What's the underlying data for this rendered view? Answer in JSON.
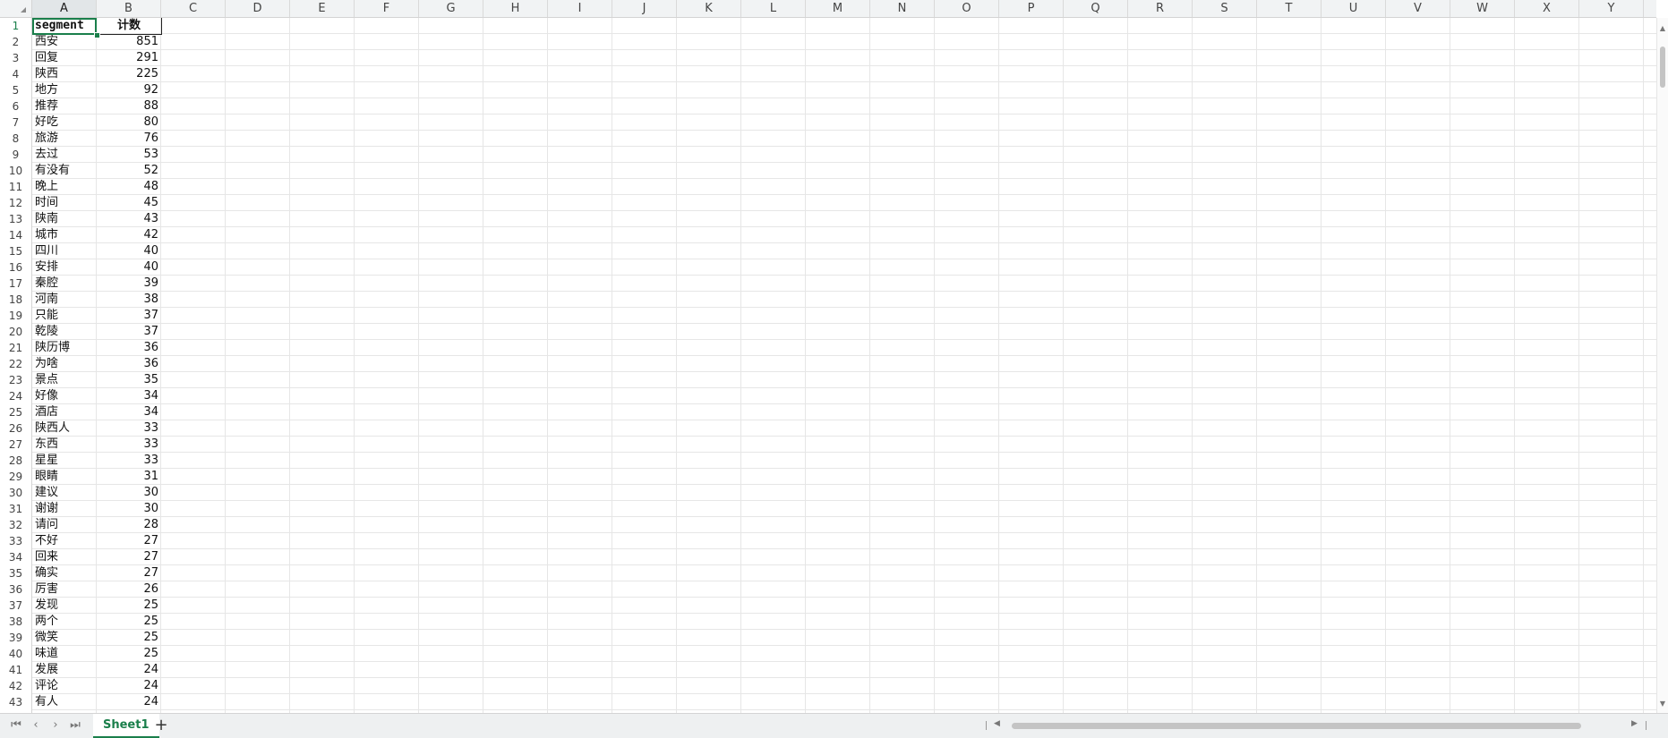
{
  "columns": [
    "A",
    "B",
    "C",
    "D",
    "E",
    "F",
    "G",
    "H",
    "I",
    "J",
    "K",
    "L",
    "M",
    "N",
    "O",
    "P",
    "Q",
    "R",
    "S",
    "T",
    "U",
    "V",
    "W",
    "X",
    "Y"
  ],
  "selected_cell": "A1",
  "header_row": {
    "a": "segment",
    "b": "计数"
  },
  "rows": [
    {
      "n": "2",
      "a": "西安",
      "b": "851"
    },
    {
      "n": "3",
      "a": "回复",
      "b": "291"
    },
    {
      "n": "4",
      "a": "陕西",
      "b": "225"
    },
    {
      "n": "5",
      "a": "地方",
      "b": "92"
    },
    {
      "n": "6",
      "a": "推荐",
      "b": "88"
    },
    {
      "n": "7",
      "a": "好吃",
      "b": "80"
    },
    {
      "n": "8",
      "a": "旅游",
      "b": "76"
    },
    {
      "n": "9",
      "a": "去过",
      "b": "53"
    },
    {
      "n": "10",
      "a": "有没有",
      "b": "52"
    },
    {
      "n": "11",
      "a": "晚上",
      "b": "48"
    },
    {
      "n": "12",
      "a": "时间",
      "b": "45"
    },
    {
      "n": "13",
      "a": "陕南",
      "b": "43"
    },
    {
      "n": "14",
      "a": "城市",
      "b": "42"
    },
    {
      "n": "15",
      "a": "四川",
      "b": "40"
    },
    {
      "n": "16",
      "a": "安排",
      "b": "40"
    },
    {
      "n": "17",
      "a": "秦腔",
      "b": "39"
    },
    {
      "n": "18",
      "a": "河南",
      "b": "38"
    },
    {
      "n": "19",
      "a": "只能",
      "b": "37"
    },
    {
      "n": "20",
      "a": "乾陵",
      "b": "37"
    },
    {
      "n": "21",
      "a": "陕历博",
      "b": "36"
    },
    {
      "n": "22",
      "a": "为啥",
      "b": "36"
    },
    {
      "n": "23",
      "a": "景点",
      "b": "35"
    },
    {
      "n": "24",
      "a": "好像",
      "b": "34"
    },
    {
      "n": "25",
      "a": "酒店",
      "b": "34"
    },
    {
      "n": "26",
      "a": "陕西人",
      "b": "33"
    },
    {
      "n": "27",
      "a": "东西",
      "b": "33"
    },
    {
      "n": "28",
      "a": "星星",
      "b": "33"
    },
    {
      "n": "29",
      "a": "眼睛",
      "b": "31"
    },
    {
      "n": "30",
      "a": "建议",
      "b": "30"
    },
    {
      "n": "31",
      "a": "谢谢",
      "b": "30"
    },
    {
      "n": "32",
      "a": "请问",
      "b": "28"
    },
    {
      "n": "33",
      "a": "不好",
      "b": "27"
    },
    {
      "n": "34",
      "a": "回来",
      "b": "27"
    },
    {
      "n": "35",
      "a": "确实",
      "b": "27"
    },
    {
      "n": "36",
      "a": "厉害",
      "b": "26"
    },
    {
      "n": "37",
      "a": "发现",
      "b": "25"
    },
    {
      "n": "38",
      "a": "两个",
      "b": "25"
    },
    {
      "n": "39",
      "a": "微笑",
      "b": "25"
    },
    {
      "n": "40",
      "a": "味道",
      "b": "25"
    },
    {
      "n": "41",
      "a": "发展",
      "b": "24"
    },
    {
      "n": "42",
      "a": "评论",
      "b": "24"
    },
    {
      "n": "43",
      "a": "有人",
      "b": "24"
    }
  ],
  "sheet_tabs": [
    "Sheet1"
  ],
  "add_sheet_label": "+",
  "nav_icons": [
    "first-sheet-icon",
    "prev-sheet-icon",
    "next-sheet-icon",
    "last-sheet-icon"
  ],
  "colors": {
    "accent": "#1a7f4b",
    "grid": "#e6e6e6",
    "header_bg": "#f1f3f4"
  }
}
